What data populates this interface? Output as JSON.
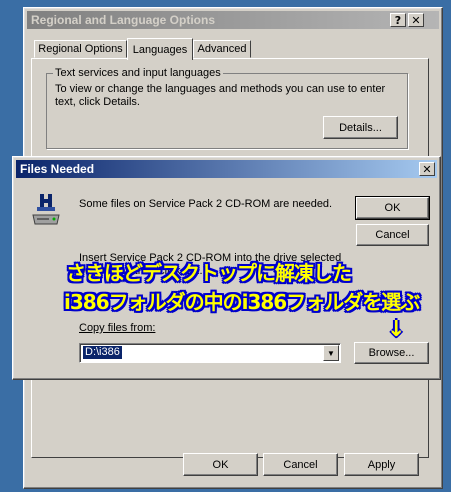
{
  "regional": {
    "title": "Regional and Language Options",
    "help_btn": "?",
    "close_btn": "✕",
    "tabs": [
      {
        "label": "Regional Options"
      },
      {
        "label": "Languages"
      },
      {
        "label": "Advanced"
      }
    ],
    "group_label": "Text services and input languages",
    "group_text": "To view or change the languages and methods you can use to enter text, click Details.",
    "details_label": "Details...",
    "ok_label": "OK",
    "cancel_label": "Cancel",
    "apply_label": "Apply"
  },
  "files_needed": {
    "title": "Files Needed",
    "close_btn": "✕",
    "message": "Some files on Service Pack 2 CD-ROM are needed.",
    "insert_line1": "Insert Service Pack 2 CD-ROM into the drive selected",
    "insert_line2": "below, and then click OK.",
    "copy_label": "Copy files from:",
    "copy_value": "D:\\i386",
    "ok_label": "OK",
    "cancel_label": "Cancel",
    "browse_label": "Browse..."
  },
  "annotation": {
    "line1": "さきほどデスクトップに解凍した",
    "line2": "i386フォルダの中のi386フォルダを選ぶ",
    "arrow": "↓"
  }
}
